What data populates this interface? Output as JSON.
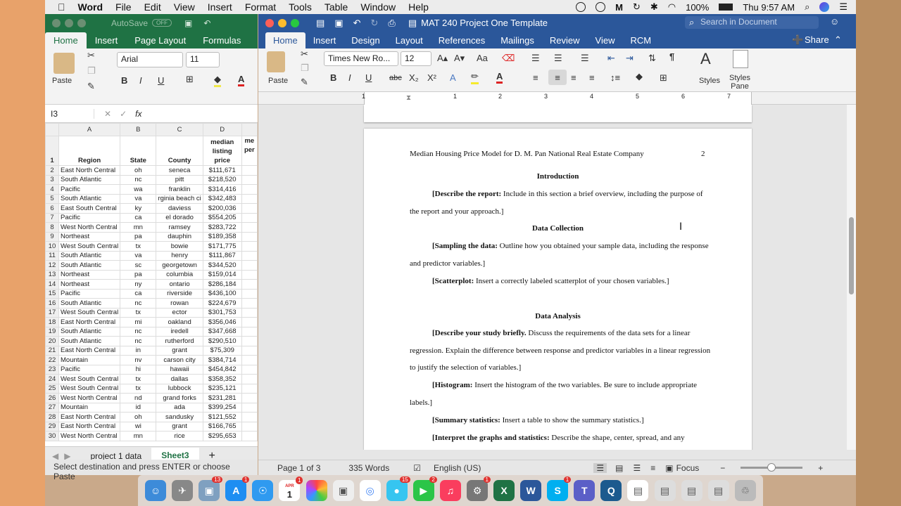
{
  "menubar": {
    "app": "Word",
    "items": [
      "File",
      "Edit",
      "View",
      "Insert",
      "Format",
      "Tools",
      "Table",
      "Window",
      "Help"
    ],
    "battery": "100%",
    "clock": "Thu 9:57 AM"
  },
  "excel": {
    "autosave": "AutoSave",
    "autosave_state": "OFF",
    "tabs": [
      "Home",
      "Insert",
      "Page Layout",
      "Formulas"
    ],
    "font": "Arial",
    "font_size": "11",
    "paste": "Paste",
    "cell_ref": "I3",
    "fx": "fx",
    "columns": [
      "A",
      "B",
      "C",
      "D"
    ],
    "headers": [
      "Region",
      "State",
      "County",
      "median listing price",
      "me per"
    ],
    "rows": [
      [
        "2",
        "East North Central",
        "oh",
        "seneca",
        "$111,671"
      ],
      [
        "3",
        "South Atlantic",
        "nc",
        "pitt",
        "$218,520"
      ],
      [
        "4",
        "Pacific",
        "wa",
        "franklin",
        "$314,416"
      ],
      [
        "5",
        "South Atlantic",
        "va",
        "rginia beach ci",
        "$342,483"
      ],
      [
        "6",
        "East South Central",
        "ky",
        "daviess",
        "$200,036"
      ],
      [
        "7",
        "Pacific",
        "ca",
        "el dorado",
        "$554,205"
      ],
      [
        "8",
        "West North Central",
        "mn",
        "ramsey",
        "$283,722"
      ],
      [
        "9",
        "Northeast",
        "pa",
        "dauphin",
        "$189,358"
      ],
      [
        "10",
        "West South Central",
        "tx",
        "bowie",
        "$171,775"
      ],
      [
        "11",
        "South Atlantic",
        "va",
        "henry",
        "$111,867"
      ],
      [
        "12",
        "South Atlantic",
        "sc",
        "georgetown",
        "$344,520"
      ],
      [
        "13",
        "Northeast",
        "pa",
        "columbia",
        "$159,014"
      ],
      [
        "14",
        "Northeast",
        "ny",
        "ontario",
        "$286,184"
      ],
      [
        "15",
        "Pacific",
        "ca",
        "riverside",
        "$436,100"
      ],
      [
        "16",
        "South Atlantic",
        "nc",
        "rowan",
        "$224,679"
      ],
      [
        "17",
        "West South Central",
        "tx",
        "ector",
        "$301,753"
      ],
      [
        "18",
        "East North Central",
        "mi",
        "oakland",
        "$356,046"
      ],
      [
        "19",
        "South Atlantic",
        "nc",
        "iredell",
        "$347,668"
      ],
      [
        "20",
        "South Atlantic",
        "nc",
        "rutherford",
        "$290,510"
      ],
      [
        "21",
        "East North Central",
        "in",
        "grant",
        "$75,309"
      ],
      [
        "22",
        "Mountain",
        "nv",
        "carson city",
        "$384,714"
      ],
      [
        "23",
        "Pacific",
        "hi",
        "hawaii",
        "$454,842"
      ],
      [
        "24",
        "West South Central",
        "tx",
        "dallas",
        "$358,352"
      ],
      [
        "25",
        "West South Central",
        "tx",
        "lubbock",
        "$235,121"
      ],
      [
        "26",
        "West North Central",
        "nd",
        "grand forks",
        "$231,281"
      ],
      [
        "27",
        "Mountain",
        "id",
        "ada",
        "$399,254"
      ],
      [
        "28",
        "East North Central",
        "oh",
        "sandusky",
        "$121,552"
      ],
      [
        "29",
        "East North Central",
        "wi",
        "grant",
        "$166,765"
      ],
      [
        "30",
        "West North Central",
        "mn",
        "rice",
        "$295,653"
      ]
    ],
    "sheet_tabs": [
      "project 1 data",
      "Sheet3"
    ],
    "status": "Select destination and press ENTER or choose Paste"
  },
  "word": {
    "title": "MAT 240 Project One Template",
    "search_placeholder": "Search in Document",
    "tabs": [
      "Home",
      "Insert",
      "Design",
      "Layout",
      "References",
      "Mailings",
      "Review",
      "View",
      "RCM"
    ],
    "share": "Share",
    "font": "Times New Ro...",
    "font_size": "12",
    "paste": "Paste",
    "styles": "Styles",
    "styles_pane": "Styles Pane",
    "ruler_marks": [
      "1",
      "1",
      "2",
      "3",
      "4",
      "5",
      "6",
      "7"
    ],
    "header_text": "Median Housing Price Model for D. M. Pan National Real Estate Company",
    "page_num": "2",
    "headings": [
      "Introduction",
      "Data Collection",
      "Data Analysis"
    ],
    "paras": [
      {
        "bold": "[Describe the report:",
        "rest": " Include in this section a brief overview, including the purpose of",
        "cont": "the report and your approach.]"
      },
      {
        "bold": "[Sampling the data:",
        "rest": " Outline how you obtained your sample data, including the response",
        "cont": "and predictor variables.]"
      },
      {
        "bold": "[Scatterplot:",
        "rest": " Insert a correctly labeled scatterplot of your chosen variables.]",
        "cont": ""
      },
      {
        "bold": "[Describe your study briefly.",
        "rest": " Discuss the requirements of the data sets for a linear",
        "cont": "regression. Explain the difference between response and predictor variables in a linear regression",
        "cont2": "to justify the selection of variables.]"
      },
      {
        "bold": "[Histogram:",
        "rest": " Insert the histogram of the two variables. Be sure to include appropriate",
        "cont": "labels.]"
      },
      {
        "bold": "[Summary statistics:",
        "rest": " Insert a table to show the summary statistics.]",
        "cont": ""
      },
      {
        "bold": "[Interpret the graphs and statistics:",
        "rest": " Describe the shape, center, spread, and any",
        "cont": ""
      }
    ],
    "status": {
      "page": "Page 1 of 3",
      "words": "335 Words",
      "lang": "English (US)",
      "focus": "Focus"
    }
  },
  "dock": {
    "badges": {
      "photos": "13",
      "appstore": "1",
      "calendar": "1",
      "calendar_month": "APR",
      "messages": "15",
      "facetime": "2",
      "prefs": "1",
      "skype": "1"
    }
  }
}
